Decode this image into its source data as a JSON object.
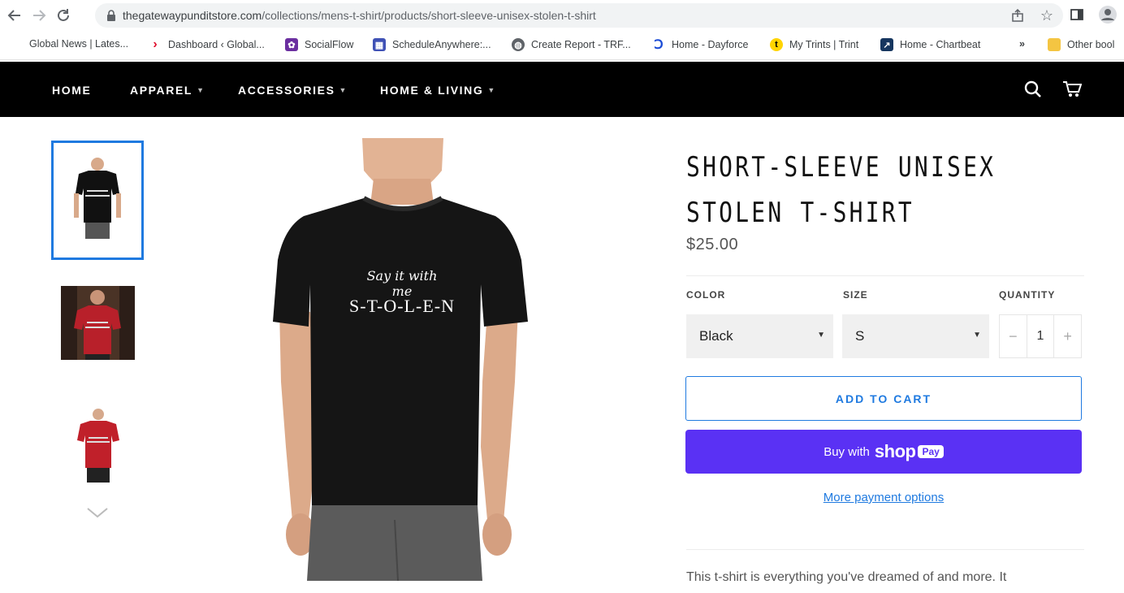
{
  "browser": {
    "url_domain": "thegatewaypunditstore.com",
    "url_path": "/collections/mens-t-shirt/products/short-sleeve-unisex-stolen-t-shirt",
    "bookmarks": [
      {
        "label": "Global News | Lates...",
        "icon": "global-news-favicon"
      },
      {
        "label": "Dashboard ‹ Global...",
        "icon": "dashboard-favicon"
      },
      {
        "label": "SocialFlow",
        "icon": "socialflow-favicon"
      },
      {
        "label": "ScheduleAnywhere:...",
        "icon": "scheduleanywhere-favicon"
      },
      {
        "label": "Create Report - TRF...",
        "icon": "globe-icon"
      },
      {
        "label": "Home - Dayforce",
        "icon": "dayforce-favicon"
      },
      {
        "label": "My Trints | Trint",
        "icon": "trint-favicon"
      },
      {
        "label": "Home - Chartbeat",
        "icon": "chartbeat-favicon"
      }
    ],
    "bookmarks_overflow": "»",
    "other_bookmarks": "Other bool"
  },
  "store_nav": {
    "items": [
      {
        "label": "HOME",
        "dropdown": false
      },
      {
        "label": "APPAREL",
        "dropdown": true
      },
      {
        "label": "ACCESSORIES",
        "dropdown": true
      },
      {
        "label": "HOME & LIVING",
        "dropdown": true
      }
    ],
    "icons": [
      "search-icon",
      "cart-icon"
    ]
  },
  "gallery": {
    "thumbnails": [
      {
        "name": "black-shirt-thumb",
        "selected": true,
        "color": "#111111"
      },
      {
        "name": "red-shirt-man-thumb",
        "selected": false,
        "color": "#b8202a"
      },
      {
        "name": "red-shirt-woman-thumb",
        "selected": false,
        "color": "#c0202a"
      }
    ],
    "shirt_line1": "Say it with me",
    "shirt_line2": "S-T-O-L-E-N"
  },
  "product": {
    "title_line1": "SHORT-SLEEVE UNISEX",
    "title_line2": "STOLEN T-SHIRT",
    "price": "$25.00",
    "color_label": "COLOR",
    "color_value": "Black",
    "size_label": "SIZE",
    "size_value": "S",
    "quantity_label": "QUANTITY",
    "quantity_minus": "−",
    "quantity_value": "1",
    "quantity_plus": "+",
    "add_to_cart": "ADD TO CART",
    "shoppay_prefix": "Buy with",
    "shoppay_shop": "shop",
    "shoppay_pay": "Pay",
    "more_payment": "More payment options",
    "description": "This t-shirt is everything you've dreamed of and more. It"
  },
  "colors": {
    "accent": "#1f7ae0",
    "shoppay": "#5a31f4",
    "nav_bg": "#000000"
  }
}
